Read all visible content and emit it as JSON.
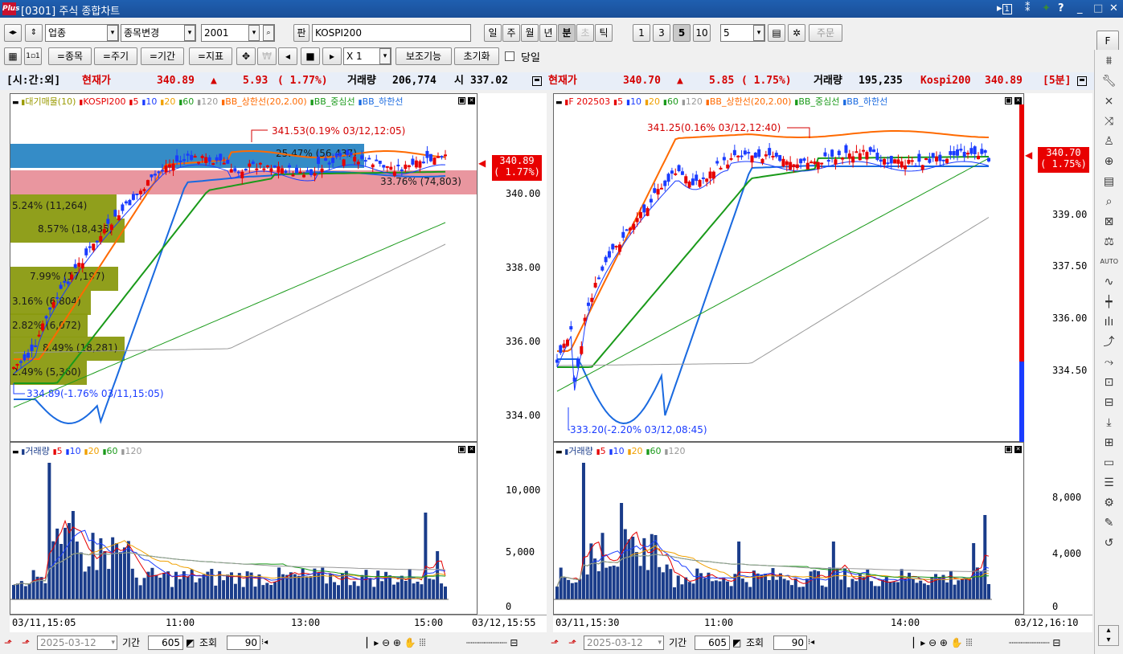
{
  "window": {
    "title": "[0301] 주식 종합차트",
    "logo": "Plus",
    "controls": [
      "▸1",
      "⁑",
      "✦",
      "?",
      "_",
      "□",
      "✕"
    ]
  },
  "toolbar1": {
    "market_select": "업종",
    "stock_change_label": "종목변경",
    "code_value": "2001",
    "pan_label": "판",
    "name_value": "KOSPI200",
    "period_buttons": [
      "일",
      "주",
      "월",
      "년",
      "분",
      "초",
      "틱"
    ],
    "active_period": "분",
    "interval_buttons": [
      "1",
      "3",
      "5",
      "10"
    ],
    "active_interval": "5",
    "interval_input": "5",
    "order_button": "주문",
    "f_button": "F"
  },
  "toolbar2": {
    "item_button": "=종목",
    "period_button": "=주기",
    "range_button": "=기간",
    "indicator_button": "=지표",
    "multiplier_label": "X 1",
    "aux_button": "보조기능",
    "reset_button": "초기화",
    "today_checkbox_label": "당일"
  },
  "infobar": {
    "left": {
      "tag": "[시:간:외]",
      "label": "현재가",
      "price": "340.89",
      "arrow": "▲",
      "change": "5.93",
      "pct": "( 1.77%)",
      "vol_label": "거래량",
      "volume": "206,774",
      "open_label": "시",
      "open": "337.02"
    },
    "right": {
      "label": "현재가",
      "price": "340.70",
      "arrow": "▲",
      "change": "5.85",
      "pct": "( 1.75%)",
      "vol_label": "거래량",
      "volume": "195,235",
      "index_label": "Kospi200",
      "index_value": "340.89",
      "period_tag": "[5분]"
    }
  },
  "left_chart": {
    "legend": [
      {
        "name": "대기매물(10)",
        "color": "#9a9a00"
      },
      {
        "name": "KOSPI200",
        "color": "#e60000"
      },
      {
        "name": "5",
        "color": "#e60000"
      },
      {
        "name": "10",
        "color": "#1a3cff"
      },
      {
        "name": "20",
        "color": "#f0a000"
      },
      {
        "name": "60",
        "color": "#1a9a1a"
      },
      {
        "name": "120",
        "color": "#999999"
      },
      {
        "name": "BB_상한선(20,2.00)",
        "color": "#ff6a00"
      },
      {
        "name": "BB_중심선",
        "color": "#1a9a1a"
      },
      {
        "name": "BB_하한선",
        "color": "#1a6ae0"
      }
    ],
    "y_ticks": [
      "340.00",
      "338.00",
      "336.00",
      "334.00"
    ],
    "current_badge": {
      "price": "340.89",
      "pct": "( 1.77%)"
    },
    "high_label": "341.53(0.19% 03/12,12:05)",
    "low_label": "334.89(-1.76% 03/11,15:05)",
    "vol_profile": [
      {
        "label": "",
        "pct": "",
        "qty": ""
      },
      {
        "label": "25.47% (56,437)"
      },
      {
        "label": "33.76% (74,803)"
      },
      {
        "label": "5.24% (11,264)"
      },
      {
        "label": "8.57% (18,435)"
      },
      {
        "label": "7.99% (17,197)"
      },
      {
        "label": "3.16% (6,804)"
      },
      {
        "label": "2.82% (6,072)"
      },
      {
        "label": "8.49% (18,281)"
      },
      {
        "label": "2.49% (5,360)"
      }
    ],
    "volume_legend": [
      {
        "name": "거래량",
        "color": "#1a3c8a"
      },
      {
        "name": "5",
        "color": "#e60000"
      },
      {
        "name": "10",
        "color": "#1a3cff"
      },
      {
        "name": "20",
        "color": "#f0a000"
      },
      {
        "name": "60",
        "color": "#1a9a1a"
      },
      {
        "name": "120",
        "color": "#999999"
      }
    ],
    "volume_ticks": [
      "10,000",
      "5,000",
      "0"
    ],
    "x_labels": [
      "03/11,15:05",
      "11:00",
      "13:00",
      "15:00",
      "03/12,15:55"
    ]
  },
  "right_chart": {
    "legend": [
      {
        "name": "F 202503",
        "color": "#e60000"
      },
      {
        "name": "5",
        "color": "#e60000"
      },
      {
        "name": "10",
        "color": "#1a3cff"
      },
      {
        "name": "20",
        "color": "#f0a000"
      },
      {
        "name": "60",
        "color": "#1a9a1a"
      },
      {
        "name": "120",
        "color": "#999999"
      },
      {
        "name": "BB_상한선(20,2.00)",
        "color": "#ff6a00"
      },
      {
        "name": "BB_중심선",
        "color": "#1a9a1a"
      },
      {
        "name": "BB_하한선",
        "color": "#1a6ae0"
      }
    ],
    "y_ticks": [
      "339.00",
      "337.50",
      "336.00",
      "334.50"
    ],
    "current_badge": {
      "price": "340.70",
      "pct": "( 1.75%)"
    },
    "high_label": "341.25(0.16% 03/12,12:40)",
    "low_label": "333.20(-2.20% 03/12,08:45)",
    "volume_legend": [
      {
        "name": "거래량",
        "color": "#1a3c8a"
      },
      {
        "name": "5",
        "color": "#e60000"
      },
      {
        "name": "10",
        "color": "#1a3cff"
      },
      {
        "name": "20",
        "color": "#f0a000"
      },
      {
        "name": "60",
        "color": "#1a9a1a"
      },
      {
        "name": "120",
        "color": "#999999"
      }
    ],
    "volume_ticks": [
      "8,000",
      "4,000",
      "0"
    ],
    "x_labels": [
      "03/11,15:30",
      "11:00",
      "14:00",
      "03/12,16:10"
    ]
  },
  "bottom_left": {
    "date": "2025-03-12",
    "period_label": "기간",
    "period_value": "605",
    "query_label": "조회",
    "count_value": "90"
  },
  "bottom_right": {
    "date": "2025-03-12",
    "period_label": "기간",
    "period_value": "605",
    "query_label": "조회",
    "count_value": "90"
  }
}
